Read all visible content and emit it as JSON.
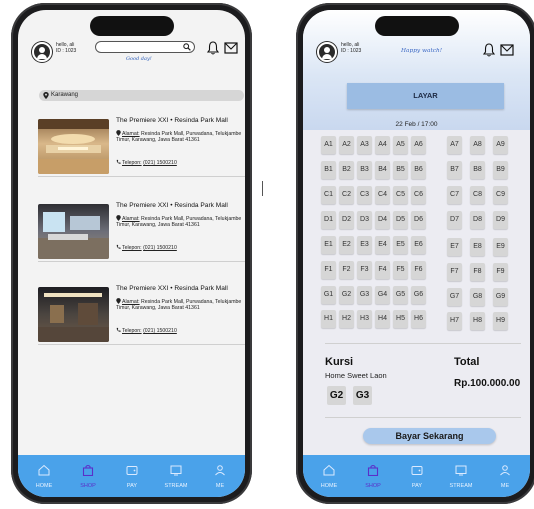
{
  "user": {
    "greeting": "hello, ali",
    "id_text": "ID : 1023"
  },
  "search": {
    "placeholder": ""
  },
  "tagline_1": "Good day!",
  "tagline_2": "Happy watch!",
  "location": "Karawang",
  "cinemas": [
    {
      "name": "The Premiere XXI • Resinda Park Mall",
      "alamat_label": "Alamat:",
      "address": "Resinda Park Mall, Purwadana, Telukjambe Timur, Karawang, Jawa Barat 41361",
      "telepon_label": "Telepon:",
      "phone": "(021) 1500210"
    },
    {
      "name": "The Premiere XXI • Resinda Park Mall",
      "alamat_label": "Alamat:",
      "address": "Resinda Park Mall, Purwadana, Telukjambe Timur, Karawang, Jawa Barat 41361",
      "telepon_label": "Telepon:",
      "phone": "(021) 1500210"
    },
    {
      "name": "The Premiere XXI • Resinda Park Mall",
      "alamat_label": "Alamat:",
      "address": "Resinda Park Mall, Purwadana, Telukjambe Timur, Karawang, Jawa Barat 41361",
      "telepon_label": "Telepon:",
      "phone": "(021) 1500210"
    }
  ],
  "nav": [
    {
      "label": "HOME",
      "icon": "home-icon",
      "active": false
    },
    {
      "label": "SHOP",
      "icon": "shopping-bag-icon",
      "active": true
    },
    {
      "label": "PAY",
      "icon": "wallet-icon",
      "active": false
    },
    {
      "label": "STREAM",
      "icon": "tv-icon",
      "active": false
    },
    {
      "label": "ME",
      "icon": "user-icon",
      "active": false
    }
  ],
  "booking": {
    "screen_label": "LAYAR",
    "showtime": "22 Feb / 17:00",
    "rows": [
      "A",
      "B",
      "C",
      "D",
      "E",
      "F",
      "G",
      "H"
    ],
    "left_cols": [
      1,
      2,
      3,
      4,
      5,
      6
    ],
    "right_cols": [
      7,
      8,
      9
    ],
    "kursi_label": "Kursi",
    "studio": "Home Sweet Laon",
    "selected_seats": [
      "G2",
      "G3"
    ],
    "total_label": "Total",
    "total_value": "Rp.100.000.00",
    "pay_button": "Bayar  Sekarang"
  },
  "colors": {
    "nav_bg": "#4aa2ea",
    "active_nav": "#5b2fc9",
    "screen_box": "#9bbce3",
    "seat": "#d6d6d6",
    "pay_button": "#a9c8ec"
  }
}
